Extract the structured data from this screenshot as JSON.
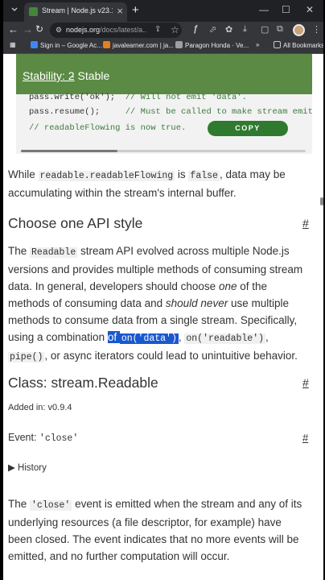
{
  "browser": {
    "tab_title": "Stream | Node.js v23.11.0 Docu",
    "tab_close": "×",
    "new_tab": "+",
    "url_host": "nodejs.org",
    "url_path": "/docs/latest/a...",
    "window_controls": [
      "—",
      "☐",
      "✕"
    ],
    "bookmarks": [
      {
        "label": "Sign in – Google Ac...",
        "icon_color": "#4285f4"
      },
      {
        "label": "javalearner.com | ja...",
        "icon_color": "#e67e22"
      },
      {
        "label": "Paragon Honda · Ve...",
        "icon_color": "#9e9e9e"
      }
    ],
    "bookmarks_overflow": "»",
    "all_bookmarks": "All Bookmarks"
  },
  "page": {
    "stability_link": "Stability: 2",
    "stability_rest": "- Stable",
    "code_lines": [
      {
        "code": "pass.write('ok');  ",
        "comment": "// Will not emit 'data'."
      },
      {
        "code": "pass.resume();     ",
        "comment": "// Must be called to make stream emit"
      },
      {
        "code": "",
        "comment": "// readableFlowing is now true."
      }
    ],
    "copy_label": "COPY",
    "para1_a": "While ",
    "para1_code1": "readable.readableFlowing",
    "para1_b": " is ",
    "para1_code2": "false",
    "para1_c": ", data may be accumulating within the stream's internal buffer.",
    "h_api_style": "Choose one API style",
    "hash": "#",
    "para2_a": "The ",
    "para2_code1": "Readable",
    "para2_b": " stream API evolved across multiple Node.js versions and provides multiple methods of consuming stream data. In general, developers should choose ",
    "para2_em1": "one",
    "para2_c": " of the methods of consuming data and ",
    "para2_em2": "should never",
    "para2_d": " use multiple methods to consume data from a single stream. Specifically, using a combination ",
    "para2_sel": "of ",
    "para2_code2": "on('data')",
    "para2_e": ", ",
    "para2_code3": "on('readable')",
    "para2_f": ", ",
    "para2_code4": "pipe()",
    "para2_g": ", or async iterators could lead to unintuitive behavior.",
    "h_class_prefix": "Class: ",
    "h_class_name": "stream.Readable",
    "added_in": "Added in: v0.9.4",
    "event_prefix": "Event: ",
    "event_name": "'close'",
    "history": "▶ History",
    "para3_a": "The ",
    "para3_code": "'close'",
    "para3_b": " event is emitted when the stream and any of its underlying resources (a file descriptor, for example) have been closed. The event indicates that no more events will be emitted, and no further computation will occur."
  }
}
